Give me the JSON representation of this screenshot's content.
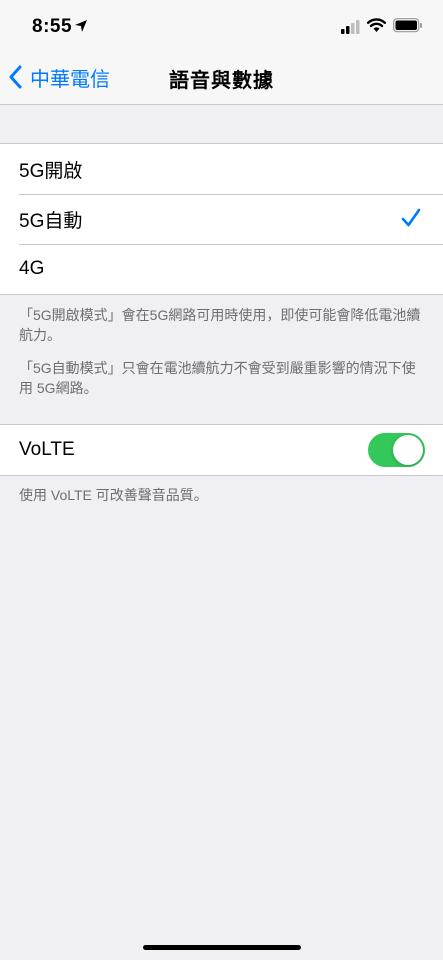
{
  "status_bar": {
    "time": "8:55",
    "icons": [
      "location-arrow-icon",
      "signal-icon",
      "wifi-icon",
      "battery-icon"
    ]
  },
  "nav": {
    "back_label": "中華電信",
    "title": "語音與數據"
  },
  "network_options": [
    {
      "label": "5G開啟",
      "selected": false
    },
    {
      "label": "5G自動",
      "selected": true
    },
    {
      "label": "4G",
      "selected": false
    }
  ],
  "footer_notes": [
    "「5G開啟模式」會在5G網路可用時使用，即使可能會降低電池續航力。",
    "「5G自動模式」只會在電池續航力不會受到嚴重影響的情況下使用 5G網路。"
  ],
  "volte": {
    "label": "VoLTE",
    "enabled": true,
    "footer": "使用 VoLTE 可改善聲音品質。"
  },
  "colors": {
    "accent": "#007aff",
    "toggle_on": "#34c759",
    "background": "#efeff4"
  }
}
